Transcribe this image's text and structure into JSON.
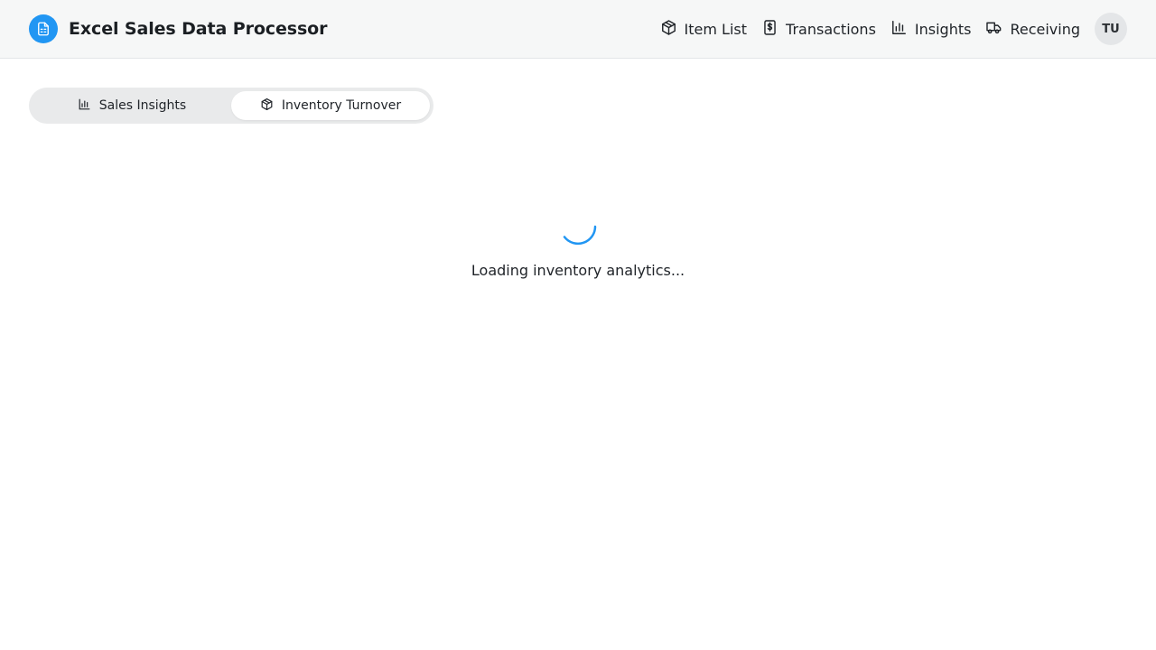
{
  "app": {
    "title": "Excel Sales Data Processor",
    "logo_icon": "spreadsheet-icon",
    "accent_color": "#2196f3"
  },
  "nav": {
    "items": [
      {
        "label": "Item List",
        "icon": "box-icon"
      },
      {
        "label": "Transactions",
        "icon": "dollar-document-icon"
      },
      {
        "label": "Insights",
        "icon": "bar-chart-icon"
      },
      {
        "label": "Receiving",
        "icon": "truck-icon"
      }
    ],
    "avatar_initials": "TU"
  },
  "tabs": [
    {
      "label": "Sales Insights",
      "icon": "bar-chart-icon",
      "active": false
    },
    {
      "label": "Inventory Turnover",
      "icon": "box-icon",
      "active": true
    }
  ],
  "loading": {
    "text": "Loading inventory analytics..."
  }
}
